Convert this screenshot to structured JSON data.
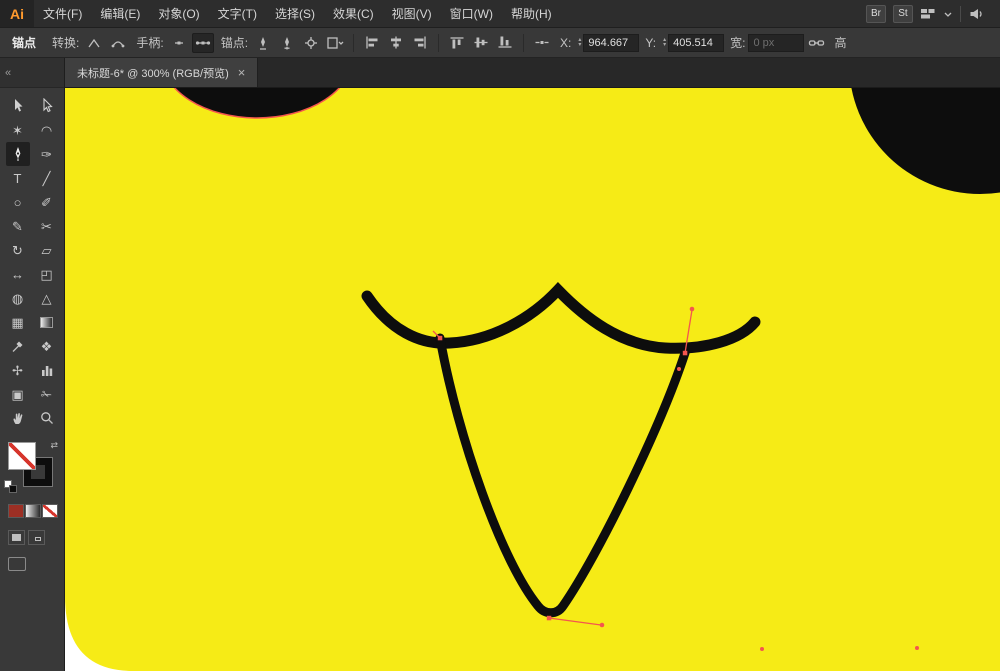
{
  "app": {
    "logo_label": "Ai"
  },
  "menu_bar": {
    "items": [
      "文件(F)",
      "编辑(E)",
      "对象(O)",
      "文字(T)",
      "选择(S)",
      "效果(C)",
      "视图(V)",
      "窗口(W)",
      "帮助(H)"
    ],
    "bridge_badge": "Br",
    "stock_badge": "St"
  },
  "control_bar": {
    "context_label": "锚点",
    "convert_label": "转换:",
    "handles_label": "手柄:",
    "anchors_label": "锚点:",
    "x_label": "X:",
    "x_value": "964.667",
    "y_label": "Y:",
    "y_value": "405.514",
    "width_label": "宽:",
    "width_value": "0 px",
    "height_label": "高",
    "spin_up": "▴",
    "spin_down": "▾"
  },
  "document_tab": {
    "title": "未标题-6* @ 300% (RGB/预览)",
    "close_label": "×"
  },
  "tools_panel": {
    "collapse_label": "«",
    "tools": [
      {
        "name": "selection-tool",
        "glyph": ""
      },
      {
        "name": "direct-selection-tool",
        "glyph": ""
      },
      {
        "name": "magic-wand-tool",
        "glyph": "✶"
      },
      {
        "name": "lasso-tool",
        "glyph": "◠"
      },
      {
        "name": "pen-tool",
        "glyph": "",
        "selected": true
      },
      {
        "name": "curvature-tool",
        "glyph": "✑"
      },
      {
        "name": "type-tool",
        "glyph": "T"
      },
      {
        "name": "line-segment-tool",
        "glyph": "╱"
      },
      {
        "name": "ellipse-tool",
        "glyph": "○"
      },
      {
        "name": "paintbrush-tool",
        "glyph": "✐"
      },
      {
        "name": "pencil-tool",
        "glyph": "✎"
      },
      {
        "name": "scissors-tool",
        "glyph": "✂"
      },
      {
        "name": "rotate-tool",
        "glyph": "↻"
      },
      {
        "name": "scale-tool",
        "glyph": "▱"
      },
      {
        "name": "width-tool",
        "glyph": "↔"
      },
      {
        "name": "free-transform-tool",
        "glyph": "◰"
      },
      {
        "name": "shape-builder-tool",
        "glyph": "◍"
      },
      {
        "name": "perspective-grid-tool",
        "glyph": "△"
      },
      {
        "name": "mesh-tool",
        "glyph": "▦"
      },
      {
        "name": "gradient-tool",
        "glyph": ""
      },
      {
        "name": "eyedropper-tool",
        "glyph": ""
      },
      {
        "name": "blend-tool",
        "glyph": "❖"
      },
      {
        "name": "symbol-sprayer-tool",
        "glyph": "✢"
      },
      {
        "name": "column-graph-tool",
        "glyph": ""
      },
      {
        "name": "artboard-tool",
        "glyph": "▣"
      },
      {
        "name": "slice-tool",
        "glyph": "✁"
      },
      {
        "name": "hand-tool",
        "glyph": ""
      },
      {
        "name": "zoom-tool",
        "glyph": ""
      }
    ]
  },
  "canvas": {
    "zoom_level": "300%",
    "colors": {
      "background_yellow": "#F6EB16",
      "shape_black": "#0D0D0D",
      "selection_red": "#F4564E",
      "artboard_white": "#FFFFFF"
    }
  }
}
